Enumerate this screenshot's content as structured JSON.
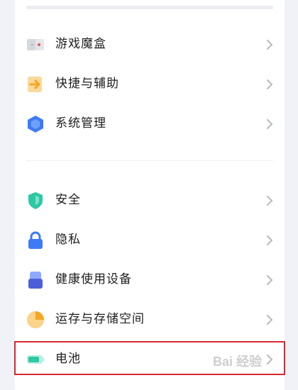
{
  "menu": {
    "group1": [
      {
        "label": "游戏魔盒",
        "icon": "game-box-icon"
      },
      {
        "label": "快捷与辅助",
        "icon": "shortcut-icon"
      },
      {
        "label": "系统管理",
        "icon": "system-icon"
      }
    ],
    "group2": [
      {
        "label": "安全",
        "icon": "shield-icon"
      },
      {
        "label": "隐私",
        "icon": "lock-icon"
      },
      {
        "label": "健康使用设备",
        "icon": "health-icon"
      },
      {
        "label": "运存与存储空间",
        "icon": "storage-pie-icon"
      },
      {
        "label": "电池",
        "icon": "battery-icon"
      }
    ]
  },
  "colors": {
    "highlight": "#d7282f",
    "accent_blue": "#3d7bf5",
    "accent_orange": "#f5a623",
    "accent_teal": "#2fc7a4"
  },
  "watermark": "Bai 经验"
}
